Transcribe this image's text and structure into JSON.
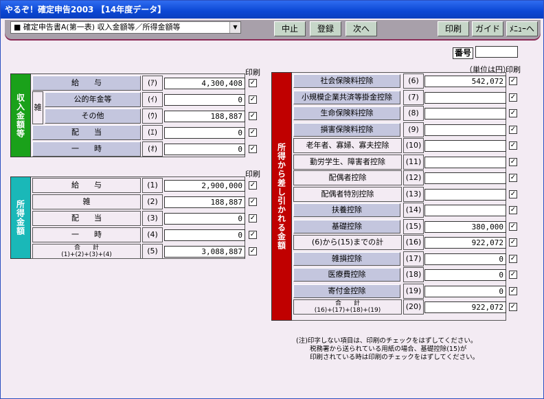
{
  "window": {
    "title": "やるぞ！確定申告2003 【14年度データ】"
  },
  "toolbar": {
    "form_select": "■ 確定申告書A(第一表) 収入金額等／所得金額等",
    "stop": "中止",
    "register": "登録",
    "next": "次へ",
    "print": "印刷",
    "guide": "ガイド",
    "menu": "ﾒﾆｭｰへ"
  },
  "header": {
    "bangou": "番号",
    "unit": "（単位は円）",
    "print_label": "印刷"
  },
  "income": {
    "title": "収入金額等",
    "zatsu": "雑",
    "rows": [
      {
        "label": "給　　与",
        "code": "(ｱ)",
        "value": "4,300,408"
      },
      {
        "label": "公的年金等",
        "code": "(ｲ)",
        "value": "0"
      },
      {
        "label": "その他",
        "code": "(ｳ)",
        "value": "188,887"
      },
      {
        "label": "配　　当",
        "code": "(ｴ)",
        "value": "0"
      },
      {
        "label": "一　　時",
        "code": "(ｵ)",
        "value": "0"
      }
    ]
  },
  "shotoku": {
    "title": "所得金額",
    "total_label": "合　　計",
    "total_formula": "(1)+(2)+(3)+(4)",
    "rows": [
      {
        "label": "給　　与",
        "code": "(1)",
        "value": "2,900,000"
      },
      {
        "label": "雑",
        "code": "(2)",
        "value": "188,887"
      },
      {
        "label": "配　　当",
        "code": "(3)",
        "value": "0"
      },
      {
        "label": "一　　時",
        "code": "(4)",
        "value": "0"
      },
      {
        "label": "",
        "code": "(5)",
        "value": "3,088,887"
      }
    ]
  },
  "deductions": {
    "title": "所得から差し引かれる金額",
    "total_label": "合　　計",
    "total_formula": "(16)+(17)+(18)+(19)",
    "rows": [
      {
        "label": "社会保険料控除",
        "code": "(6)",
        "value": "542,072",
        "btn": true
      },
      {
        "label": "小規模企業共済等掛金控除",
        "code": "(7)",
        "value": "",
        "btn": true
      },
      {
        "label": "生命保険料控除",
        "code": "(8)",
        "value": "",
        "btn": true
      },
      {
        "label": "損害保険料控除",
        "code": "(9)",
        "value": "",
        "btn": true
      },
      {
        "label": "老年者、寡婦、寡夫控除",
        "code": "(10)",
        "value": "",
        "btn": false
      },
      {
        "label": "勤労学生、障害者控除",
        "code": "(11)",
        "value": "",
        "btn": false
      },
      {
        "label": "配偶者控除",
        "code": "(12)",
        "value": "",
        "btn": false
      },
      {
        "label": "配偶者特別控除",
        "code": "(13)",
        "value": "",
        "btn": false
      },
      {
        "label": "扶養控除",
        "code": "(14)",
        "value": "",
        "btn": true
      },
      {
        "label": "基礎控除",
        "code": "(15)",
        "value": "380,000",
        "btn": true
      },
      {
        "label": "(6)から(15)までの計",
        "code": "(16)",
        "value": "922,072",
        "btn": false
      },
      {
        "label": "雑損控除",
        "code": "(17)",
        "value": "0",
        "btn": true
      },
      {
        "label": "医療費控除",
        "code": "(18)",
        "value": "0",
        "btn": true
      },
      {
        "label": "寄付金控除",
        "code": "(19)",
        "value": "0",
        "btn": true
      },
      {
        "label": "",
        "code": "(20)",
        "value": "922,072",
        "btn": false
      }
    ]
  },
  "notes": [
    "(注)印字しない項目は、印刷のチェックをはずしてください。",
    "税務署から送られている用紙の場合、基礎控除(15)が",
    "印刷されている時は印刷のチェックをはずしてください。"
  ],
  "check_mark": "✓",
  "colors": {
    "income": "#1aa11a",
    "shotoku": "#1ab8b8",
    "deduction": "#c00000"
  }
}
